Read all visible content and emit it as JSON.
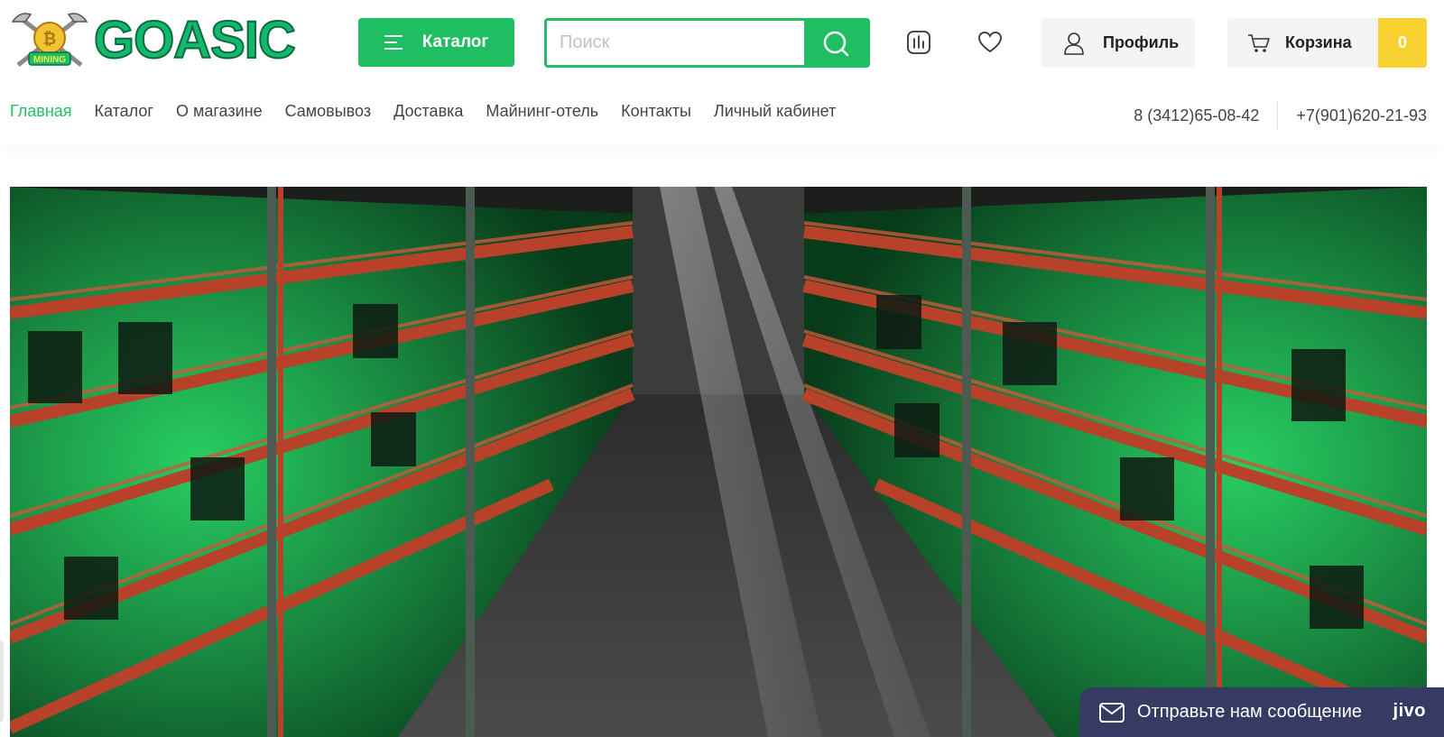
{
  "header": {
    "logo_text": "GOASIC",
    "logo_badge_text": "MINING",
    "catalog_button": "Каталог",
    "search_placeholder": "Поиск",
    "compare_icon": "chart-bars-icon",
    "favorites_icon": "heart-icon",
    "profile_label": "Профиль",
    "cart_label": "Корзина",
    "cart_count": "0"
  },
  "nav": {
    "items": [
      {
        "label": "Главная",
        "active": true
      },
      {
        "label": "Каталог"
      },
      {
        "label": "О магазине"
      },
      {
        "label": "Самовывоз"
      },
      {
        "label": "Доставка"
      },
      {
        "label": "Майнинг-отель"
      },
      {
        "label": "Контакты"
      },
      {
        "label": "Личный кабинет"
      }
    ],
    "phones": [
      "8 (3412)65-08-42",
      "+7(901)620-21-93"
    ]
  },
  "hero": {
    "image": "mining-farm-racks-photo"
  },
  "chat_widget": {
    "label": "Отправьте нам сообщение",
    "brand": "jivo"
  },
  "colors": {
    "accent": "#1fbe63",
    "cart_badge": "#f7d231",
    "chat_bg": "#363b64"
  }
}
